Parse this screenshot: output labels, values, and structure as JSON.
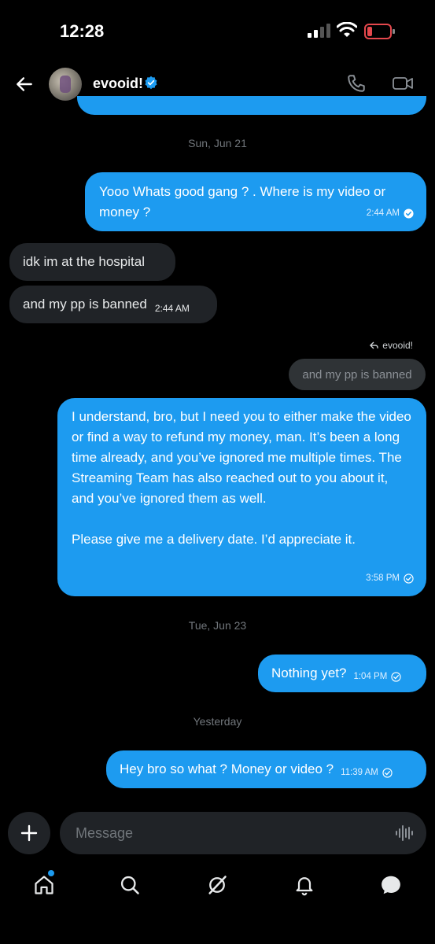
{
  "status": {
    "time": "12:28"
  },
  "header": {
    "contact_name": "evooid!"
  },
  "date_separators": [
    "Sun, Jun 21",
    "Tue, Jun 23",
    "Yesterday"
  ],
  "messages": [
    {
      "text": "Yooo Whats good gang ? . Where is my video or money ?",
      "time": "2:44 AM"
    },
    {
      "text": "idk im at the hospital"
    },
    {
      "text": "and my pp is banned",
      "time": "2:44 AM"
    },
    {
      "reply_to": "evooid!",
      "quoted_text": "and my pp is banned",
      "paragraph1": "I understand, bro, but I need you to either make the video or find a way to refund my money, man. It’s been a long time already, and you’ve ignored me multiple times. The Streaming Team has also reached out to you about it, and you’ve ignored them as well.",
      "paragraph2": "Please give me a delivery date. I’d appreciate it.",
      "time": "3:58 PM"
    },
    {
      "text": "Nothing yet?",
      "time": "1:04 PM"
    },
    {
      "text": "Hey bro so what ? Money or video ?",
      "time": "11:39 AM"
    }
  ],
  "composer": {
    "placeholder": "Message"
  },
  "colors": {
    "accent": "#1d9bf0",
    "incoming_bubble": "#202327",
    "background": "#000000"
  },
  "tabs": [
    "home-icon",
    "search-icon",
    "grok-icon",
    "notifications-icon",
    "messages-icon"
  ]
}
